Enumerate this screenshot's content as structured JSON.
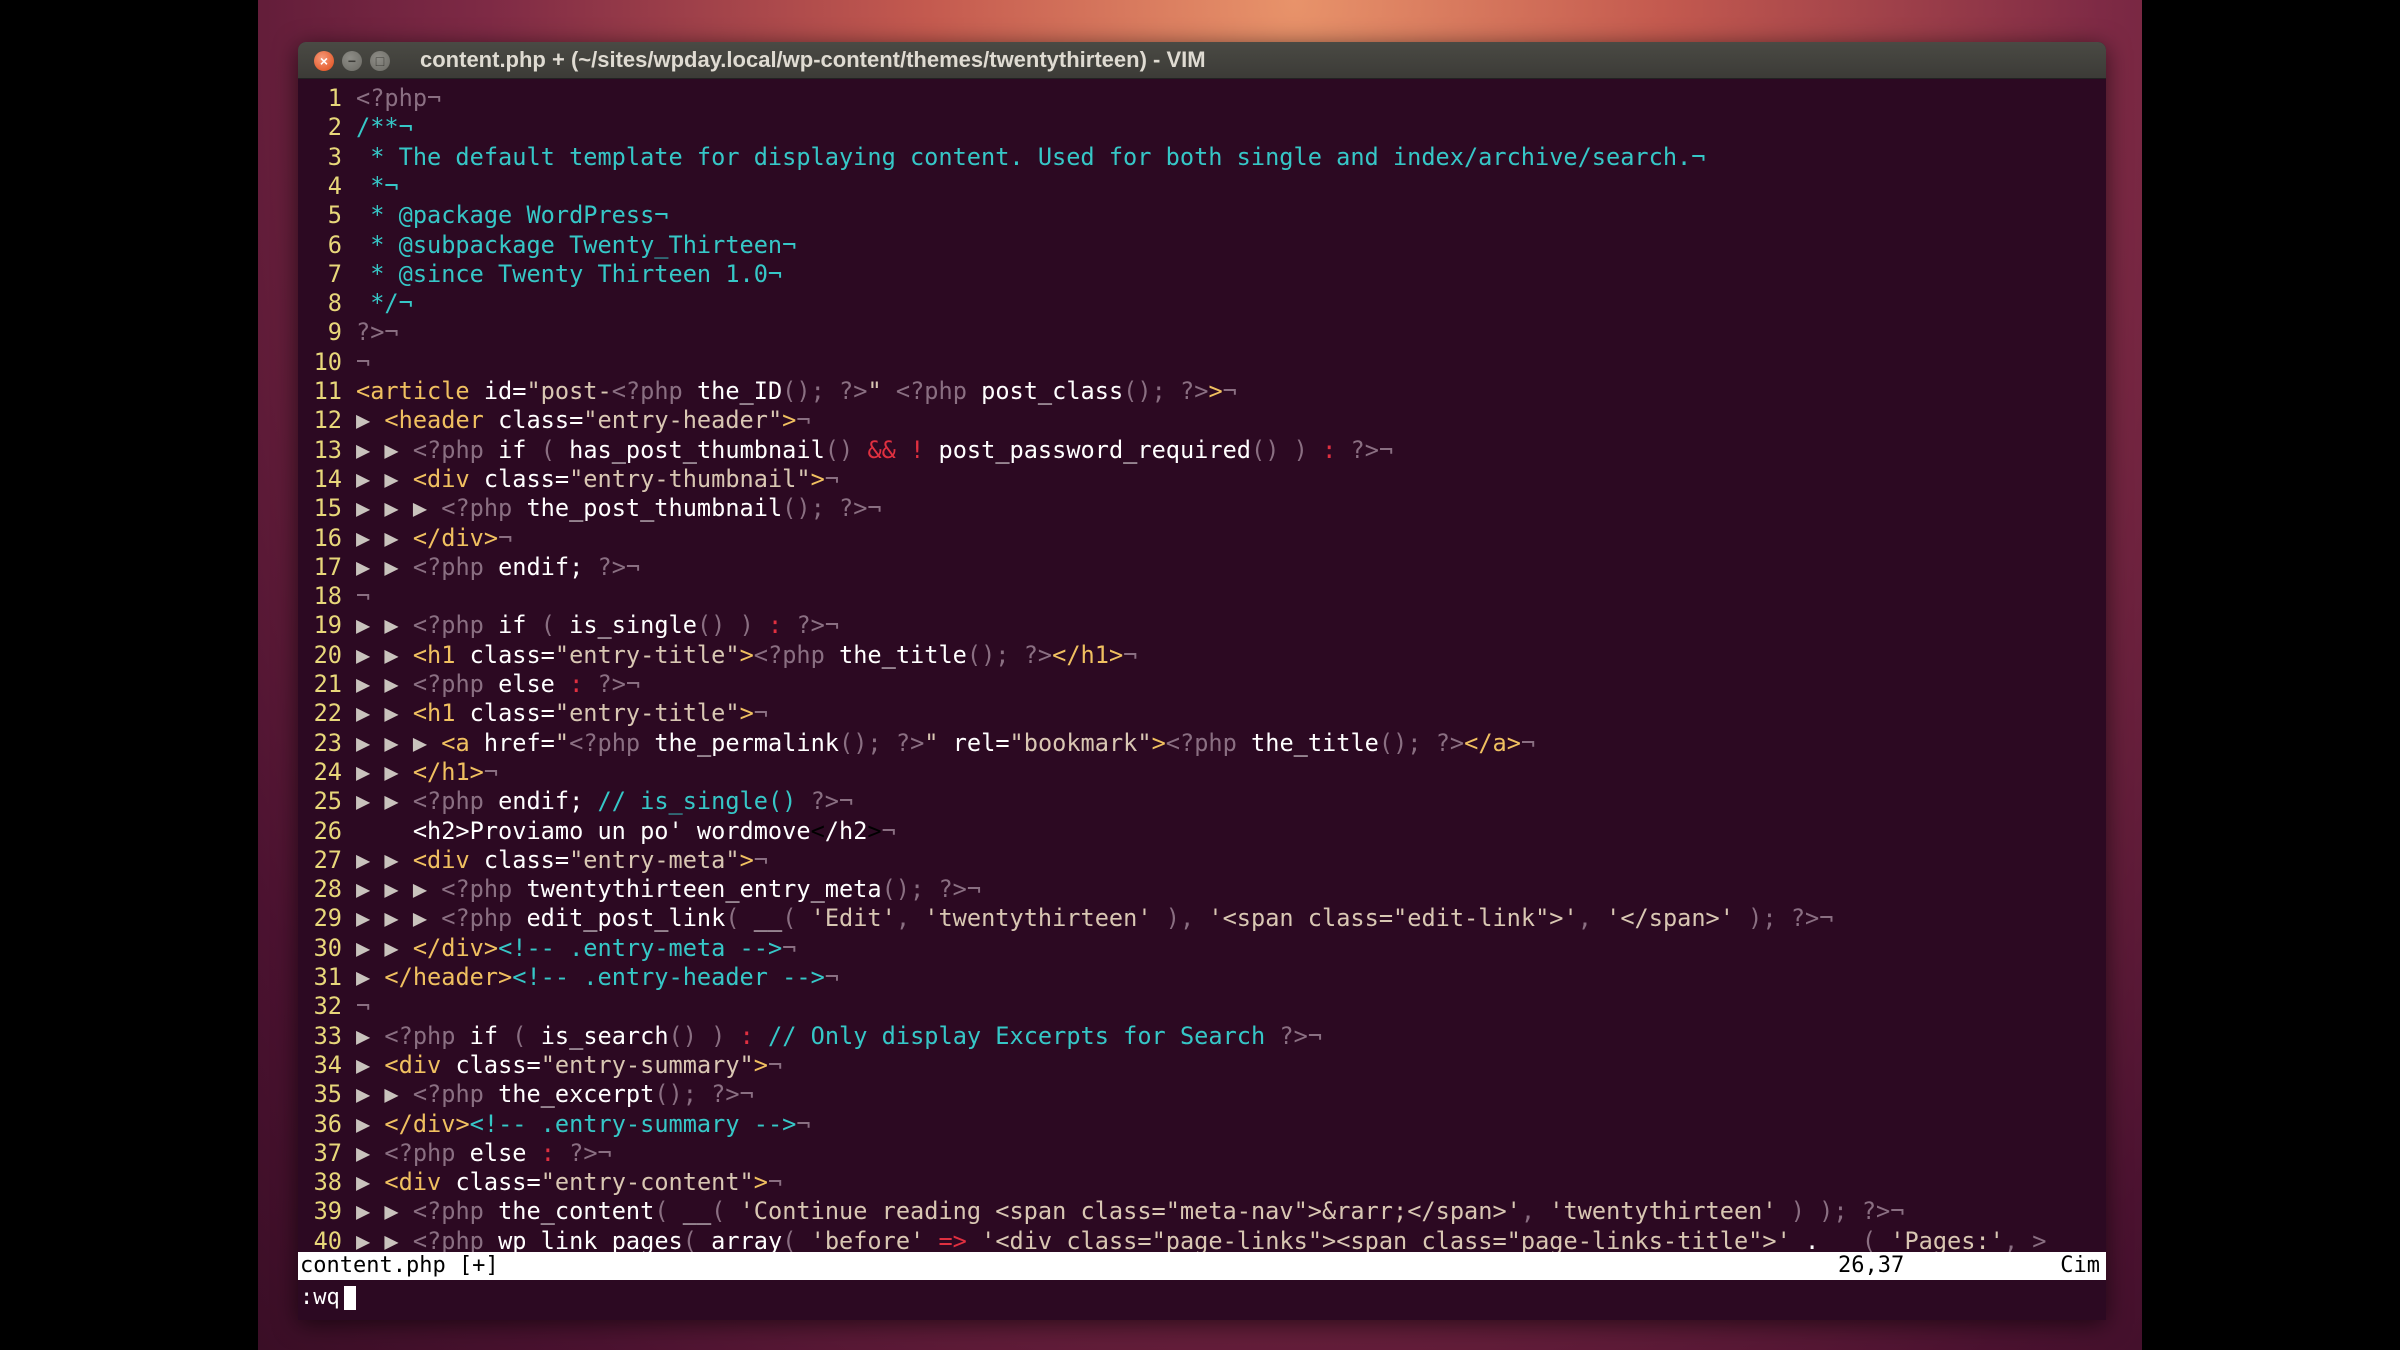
{
  "window": {
    "title": "content.php + (~/sites/wpday.local/wp-content/themes/twentythirteen) - VIM",
    "close_icon": "close-icon",
    "minimize_icon": "minimize-icon",
    "maximize_icon": "maximize-icon"
  },
  "lines": [
    {
      "n": "1",
      "parts": [
        [
          "gray",
          "<?php¬"
        ]
      ]
    },
    {
      "n": "2",
      "parts": [
        [
          "cmt",
          "/**¬"
        ]
      ]
    },
    {
      "n": "3",
      "parts": [
        [
          "cmt",
          " * The default template for displaying content. Used for both single and index/archive/search.¬"
        ]
      ]
    },
    {
      "n": "4",
      "parts": [
        [
          "cmt",
          " *¬"
        ]
      ]
    },
    {
      "n": "5",
      "parts": [
        [
          "cmt",
          " * @package WordPress¬"
        ]
      ]
    },
    {
      "n": "6",
      "parts": [
        [
          "cmt",
          " * @subpackage Twenty_Thirteen¬"
        ]
      ]
    },
    {
      "n": "7",
      "parts": [
        [
          "cmt",
          " * @since Twenty Thirteen 1.0¬"
        ]
      ]
    },
    {
      "n": "8",
      "parts": [
        [
          "cmt",
          " */¬"
        ]
      ]
    },
    {
      "n": "9",
      "parts": [
        [
          "gray",
          "?>¬"
        ]
      ]
    },
    {
      "n": "10",
      "parts": [
        [
          "gray",
          "¬"
        ]
      ]
    },
    {
      "n": "11",
      "parts": [
        [
          "tag",
          "<article"
        ],
        [
          "white",
          " id="
        ],
        [
          "str",
          "\"post-"
        ],
        [
          "gray",
          "<?php"
        ],
        [
          "white",
          " the_ID"
        ],
        [
          "gray",
          "();"
        ],
        [
          "white",
          " "
        ],
        [
          "gray",
          "?>"
        ],
        [
          "str",
          "\""
        ],
        [
          "white",
          " "
        ],
        [
          "gray",
          "<?php"
        ],
        [
          "white",
          " post_class"
        ],
        [
          "gray",
          "();"
        ],
        [
          "white",
          " "
        ],
        [
          "gray",
          "?>"
        ],
        [
          "tag",
          ">"
        ],
        [
          "gray",
          "¬"
        ]
      ]
    },
    {
      "n": "12",
      "parts": [
        [
          "ind",
          "▶ "
        ],
        [
          "tag",
          "<header"
        ],
        [
          "white",
          " class="
        ],
        [
          "str",
          "\"entry-header\""
        ],
        [
          "tag",
          ">"
        ],
        [
          "gray",
          "¬"
        ]
      ]
    },
    {
      "n": "13",
      "parts": [
        [
          "ind",
          "▶ ▶ "
        ],
        [
          "gray",
          "<?php"
        ],
        [
          "white",
          " if "
        ],
        [
          "gray",
          "( "
        ],
        [
          "white",
          "has_post_thumbnail"
        ],
        [
          "gray",
          "()"
        ],
        [
          "white",
          " "
        ],
        [
          "op",
          "&&"
        ],
        [
          "white",
          " "
        ],
        [
          "op",
          "!"
        ],
        [
          "white",
          " post_password_required"
        ],
        [
          "gray",
          "()"
        ],
        [
          "white",
          " "
        ],
        [
          "gray",
          ")"
        ],
        [
          "white",
          " "
        ],
        [
          "op",
          ":"
        ],
        [
          "white",
          " "
        ],
        [
          "gray",
          "?>¬"
        ]
      ]
    },
    {
      "n": "14",
      "parts": [
        [
          "ind",
          "▶ ▶ "
        ],
        [
          "tag",
          "<div"
        ],
        [
          "white",
          " class="
        ],
        [
          "str",
          "\"entry-thumbnail\""
        ],
        [
          "tag",
          ">"
        ],
        [
          "gray",
          "¬"
        ]
      ]
    },
    {
      "n": "15",
      "parts": [
        [
          "ind",
          "▶ ▶ ▶ "
        ],
        [
          "gray",
          "<?php"
        ],
        [
          "white",
          " the_post_thumbnail"
        ],
        [
          "gray",
          "();"
        ],
        [
          "white",
          " "
        ],
        [
          "gray",
          "?>¬"
        ]
      ]
    },
    {
      "n": "16",
      "parts": [
        [
          "ind",
          "▶ ▶ "
        ],
        [
          "tag",
          "</div>"
        ],
        [
          "gray",
          "¬"
        ]
      ]
    },
    {
      "n": "17",
      "parts": [
        [
          "ind",
          "▶ ▶ "
        ],
        [
          "gray",
          "<?php"
        ],
        [
          "white",
          " endif; "
        ],
        [
          "gray",
          "?>¬"
        ]
      ]
    },
    {
      "n": "18",
      "parts": [
        [
          "gray",
          "¬"
        ]
      ]
    },
    {
      "n": "19",
      "parts": [
        [
          "ind",
          "▶ ▶ "
        ],
        [
          "gray",
          "<?php"
        ],
        [
          "white",
          " if "
        ],
        [
          "gray",
          "( "
        ],
        [
          "white",
          "is_single"
        ],
        [
          "gray",
          "() )"
        ],
        [
          "white",
          " "
        ],
        [
          "op",
          ":"
        ],
        [
          "white",
          " "
        ],
        [
          "gray",
          "?>¬"
        ]
      ]
    },
    {
      "n": "20",
      "parts": [
        [
          "ind",
          "▶ ▶ "
        ],
        [
          "tag",
          "<h1"
        ],
        [
          "white",
          " class="
        ],
        [
          "str",
          "\"entry-title\""
        ],
        [
          "tag",
          ">"
        ],
        [
          "gray",
          "<?php"
        ],
        [
          "white",
          " the_title"
        ],
        [
          "gray",
          "();"
        ],
        [
          "white",
          " "
        ],
        [
          "gray",
          "?>"
        ],
        [
          "tag",
          "</h1>"
        ],
        [
          "gray",
          "¬"
        ]
      ]
    },
    {
      "n": "21",
      "parts": [
        [
          "ind",
          "▶ ▶ "
        ],
        [
          "gray",
          "<?php"
        ],
        [
          "white",
          " else "
        ],
        [
          "op",
          ":"
        ],
        [
          "white",
          " "
        ],
        [
          "gray",
          "?>¬"
        ]
      ]
    },
    {
      "n": "22",
      "parts": [
        [
          "ind",
          "▶ ▶ "
        ],
        [
          "tag",
          "<h1"
        ],
        [
          "white",
          " class="
        ],
        [
          "str",
          "\"entry-title\""
        ],
        [
          "tag",
          ">"
        ],
        [
          "gray",
          "¬"
        ]
      ]
    },
    {
      "n": "23",
      "parts": [
        [
          "ind",
          "▶ ▶ ▶ "
        ],
        [
          "tag",
          "<a"
        ],
        [
          "white",
          " href="
        ],
        [
          "str",
          "\""
        ],
        [
          "gray",
          "<?php"
        ],
        [
          "white",
          " the_permalink"
        ],
        [
          "gray",
          "();"
        ],
        [
          "white",
          " "
        ],
        [
          "gray",
          "?>"
        ],
        [
          "str",
          "\""
        ],
        [
          "white",
          " rel="
        ],
        [
          "str",
          "\"bookmark\""
        ],
        [
          "tag",
          ">"
        ],
        [
          "gray",
          "<?php"
        ],
        [
          "white",
          " the_title"
        ],
        [
          "gray",
          "();"
        ],
        [
          "white",
          " "
        ],
        [
          "gray",
          "?>"
        ],
        [
          "tag",
          "</a>"
        ],
        [
          "gray",
          "¬"
        ]
      ]
    },
    {
      "n": "24",
      "parts": [
        [
          "ind",
          "▶ ▶ "
        ],
        [
          "tag",
          "</h1>"
        ],
        [
          "gray",
          "¬"
        ]
      ]
    },
    {
      "n": "25",
      "parts": [
        [
          "ind",
          "▶ ▶ "
        ],
        [
          "gray",
          "<?php"
        ],
        [
          "white",
          " endif; "
        ],
        [
          "cmt",
          "// is_single()"
        ],
        [
          "white",
          " "
        ],
        [
          "gray",
          "?>¬"
        ]
      ]
    },
    {
      "n": "26",
      "parts": [
        [
          "white",
          "    <h2>Proviamo un po' wordmove"
        ],
        [
          "cursor",
          "<"
        ],
        [
          "white",
          "/h2"
        ],
        [
          "cursor",
          ">"
        ],
        [
          "gray",
          "¬"
        ]
      ]
    },
    {
      "n": "27",
      "parts": [
        [
          "ind",
          "▶ ▶ "
        ],
        [
          "tag",
          "<div"
        ],
        [
          "white",
          " class="
        ],
        [
          "str",
          "\"entry-meta\""
        ],
        [
          "tag",
          ">"
        ],
        [
          "gray",
          "¬"
        ]
      ]
    },
    {
      "n": "28",
      "parts": [
        [
          "ind",
          "▶ ▶ ▶ "
        ],
        [
          "gray",
          "<?php"
        ],
        [
          "white",
          " twentythirteen_entry_meta"
        ],
        [
          "gray",
          "();"
        ],
        [
          "white",
          " "
        ],
        [
          "gray",
          "?>¬"
        ]
      ]
    },
    {
      "n": "29",
      "parts": [
        [
          "ind",
          "▶ ▶ ▶ "
        ],
        [
          "gray",
          "<?php"
        ],
        [
          "white",
          " edit_post_link"
        ],
        [
          "gray",
          "( "
        ],
        [
          "white",
          "__"
        ],
        [
          "gray",
          "( "
        ],
        [
          "str",
          "'Edit'"
        ],
        [
          "gray",
          ", "
        ],
        [
          "str",
          "'twentythirteen'"
        ],
        [
          "gray",
          " ), "
        ],
        [
          "str",
          "'<span class=\"edit-link\">'"
        ],
        [
          "gray",
          ", "
        ],
        [
          "str",
          "'</span>'"
        ],
        [
          "gray",
          " );"
        ],
        [
          "white",
          " "
        ],
        [
          "gray",
          "?>¬"
        ]
      ]
    },
    {
      "n": "30",
      "parts": [
        [
          "ind",
          "▶ ▶ "
        ],
        [
          "tag",
          "</div>"
        ],
        [
          "cmt",
          "<!-- .entry-meta -->"
        ],
        [
          "gray",
          "¬"
        ]
      ]
    },
    {
      "n": "31",
      "parts": [
        [
          "ind",
          "▶ "
        ],
        [
          "tag",
          "</header>"
        ],
        [
          "cmt",
          "<!-- .entry-header -->"
        ],
        [
          "gray",
          "¬"
        ]
      ]
    },
    {
      "n": "32",
      "parts": [
        [
          "gray",
          "¬"
        ]
      ]
    },
    {
      "n": "33",
      "parts": [
        [
          "ind",
          "▶ "
        ],
        [
          "gray",
          "<?php"
        ],
        [
          "white",
          " if "
        ],
        [
          "gray",
          "( "
        ],
        [
          "white",
          "is_search"
        ],
        [
          "gray",
          "() )"
        ],
        [
          "white",
          " "
        ],
        [
          "op",
          ":"
        ],
        [
          "white",
          " "
        ],
        [
          "cmt",
          "// Only display Excerpts for Search"
        ],
        [
          "white",
          " "
        ],
        [
          "gray",
          "?>¬"
        ]
      ]
    },
    {
      "n": "34",
      "parts": [
        [
          "ind",
          "▶ "
        ],
        [
          "tag",
          "<div"
        ],
        [
          "white",
          " class="
        ],
        [
          "str",
          "\"entry-summary\""
        ],
        [
          "tag",
          ">"
        ],
        [
          "gray",
          "¬"
        ]
      ]
    },
    {
      "n": "35",
      "parts": [
        [
          "ind",
          "▶ ▶ "
        ],
        [
          "gray",
          "<?php"
        ],
        [
          "white",
          " the_excerpt"
        ],
        [
          "gray",
          "();"
        ],
        [
          "white",
          " "
        ],
        [
          "gray",
          "?>¬"
        ]
      ]
    },
    {
      "n": "36",
      "parts": [
        [
          "ind",
          "▶ "
        ],
        [
          "tag",
          "</div>"
        ],
        [
          "cmt",
          "<!-- .entry-summary -->"
        ],
        [
          "gray",
          "¬"
        ]
      ]
    },
    {
      "n": "37",
      "parts": [
        [
          "ind",
          "▶ "
        ],
        [
          "gray",
          "<?php"
        ],
        [
          "white",
          " else "
        ],
        [
          "op",
          ":"
        ],
        [
          "white",
          " "
        ],
        [
          "gray",
          "?>¬"
        ]
      ]
    },
    {
      "n": "38",
      "parts": [
        [
          "ind",
          "▶ "
        ],
        [
          "tag",
          "<div"
        ],
        [
          "white",
          " class="
        ],
        [
          "str",
          "\"entry-content\""
        ],
        [
          "tag",
          ">"
        ],
        [
          "gray",
          "¬"
        ]
      ]
    },
    {
      "n": "39",
      "parts": [
        [
          "ind",
          "▶ ▶ "
        ],
        [
          "gray",
          "<?php"
        ],
        [
          "white",
          " the_content"
        ],
        [
          "gray",
          "( "
        ],
        [
          "white",
          "__"
        ],
        [
          "gray",
          "( "
        ],
        [
          "str",
          "'Continue reading <span class=\"meta-nav\">&rarr;</span>'"
        ],
        [
          "gray",
          ", "
        ],
        [
          "str",
          "'twentythirteen'"
        ],
        [
          "gray",
          " ) );"
        ],
        [
          "white",
          " "
        ],
        [
          "gray",
          "?>¬"
        ]
      ]
    },
    {
      "n": "40",
      "parts": [
        [
          "ind",
          "▶ ▶ "
        ],
        [
          "gray",
          "<?php"
        ],
        [
          "white",
          " wp_link_pages"
        ],
        [
          "gray",
          "( "
        ],
        [
          "white",
          "array"
        ],
        [
          "gray",
          "( "
        ],
        [
          "str",
          "'before'"
        ],
        [
          "white",
          " "
        ],
        [
          "op",
          "=>"
        ],
        [
          "white",
          " "
        ],
        [
          "str",
          "'<div class=\"page-links\"><span class=\"page-links-title\">'"
        ],
        [
          "white",
          " . "
        ],
        [
          "gray",
          "__( "
        ],
        [
          "str",
          "'Pages:'"
        ],
        [
          "gray",
          ", >"
        ]
      ]
    }
  ],
  "statusbar": {
    "file": "content.php [+]",
    "position": "26,37",
    "scroll": "Cim"
  },
  "cmdline": {
    "text": ":wq"
  }
}
